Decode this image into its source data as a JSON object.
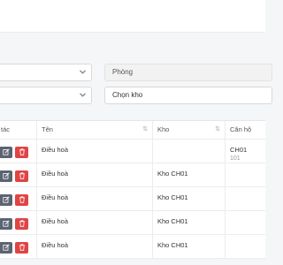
{
  "filters": {
    "left_select_1": "",
    "left_select_2": "",
    "room": {
      "placeholder": "Phòng"
    },
    "warehouse": {
      "placeholder": "Chọn kho"
    }
  },
  "table": {
    "columns": [
      {
        "label": "tác"
      },
      {
        "label": "Tên"
      },
      {
        "label": "Kho"
      },
      {
        "label": "Căn hộ"
      }
    ],
    "rows": [
      {
        "name": "Điều hoà",
        "warehouse": "",
        "apartment": "CH01",
        "apartment_sub": "101"
      },
      {
        "name": "Điều hoà",
        "warehouse": "Kho CH01",
        "apartment": "",
        "apartment_sub": ""
      },
      {
        "name": "Điều hoà",
        "warehouse": "Kho CH01",
        "apartment": "",
        "apartment_sub": ""
      },
      {
        "name": "Điều hoà",
        "warehouse": "Kho CH01",
        "apartment": "",
        "apartment_sub": ""
      },
      {
        "name": "Điều hoà",
        "warehouse": "Kho CH01",
        "apartment": "",
        "apartment_sub": ""
      }
    ]
  },
  "icons": {
    "chevron": "chevron-down-icon",
    "sort": "sort-icon",
    "edit": "edit-icon",
    "delete": "trash-icon"
  },
  "colors": {
    "edit_button": "#5b6470",
    "delete_button": "#e04444",
    "page_background": "#f5f6f8"
  }
}
